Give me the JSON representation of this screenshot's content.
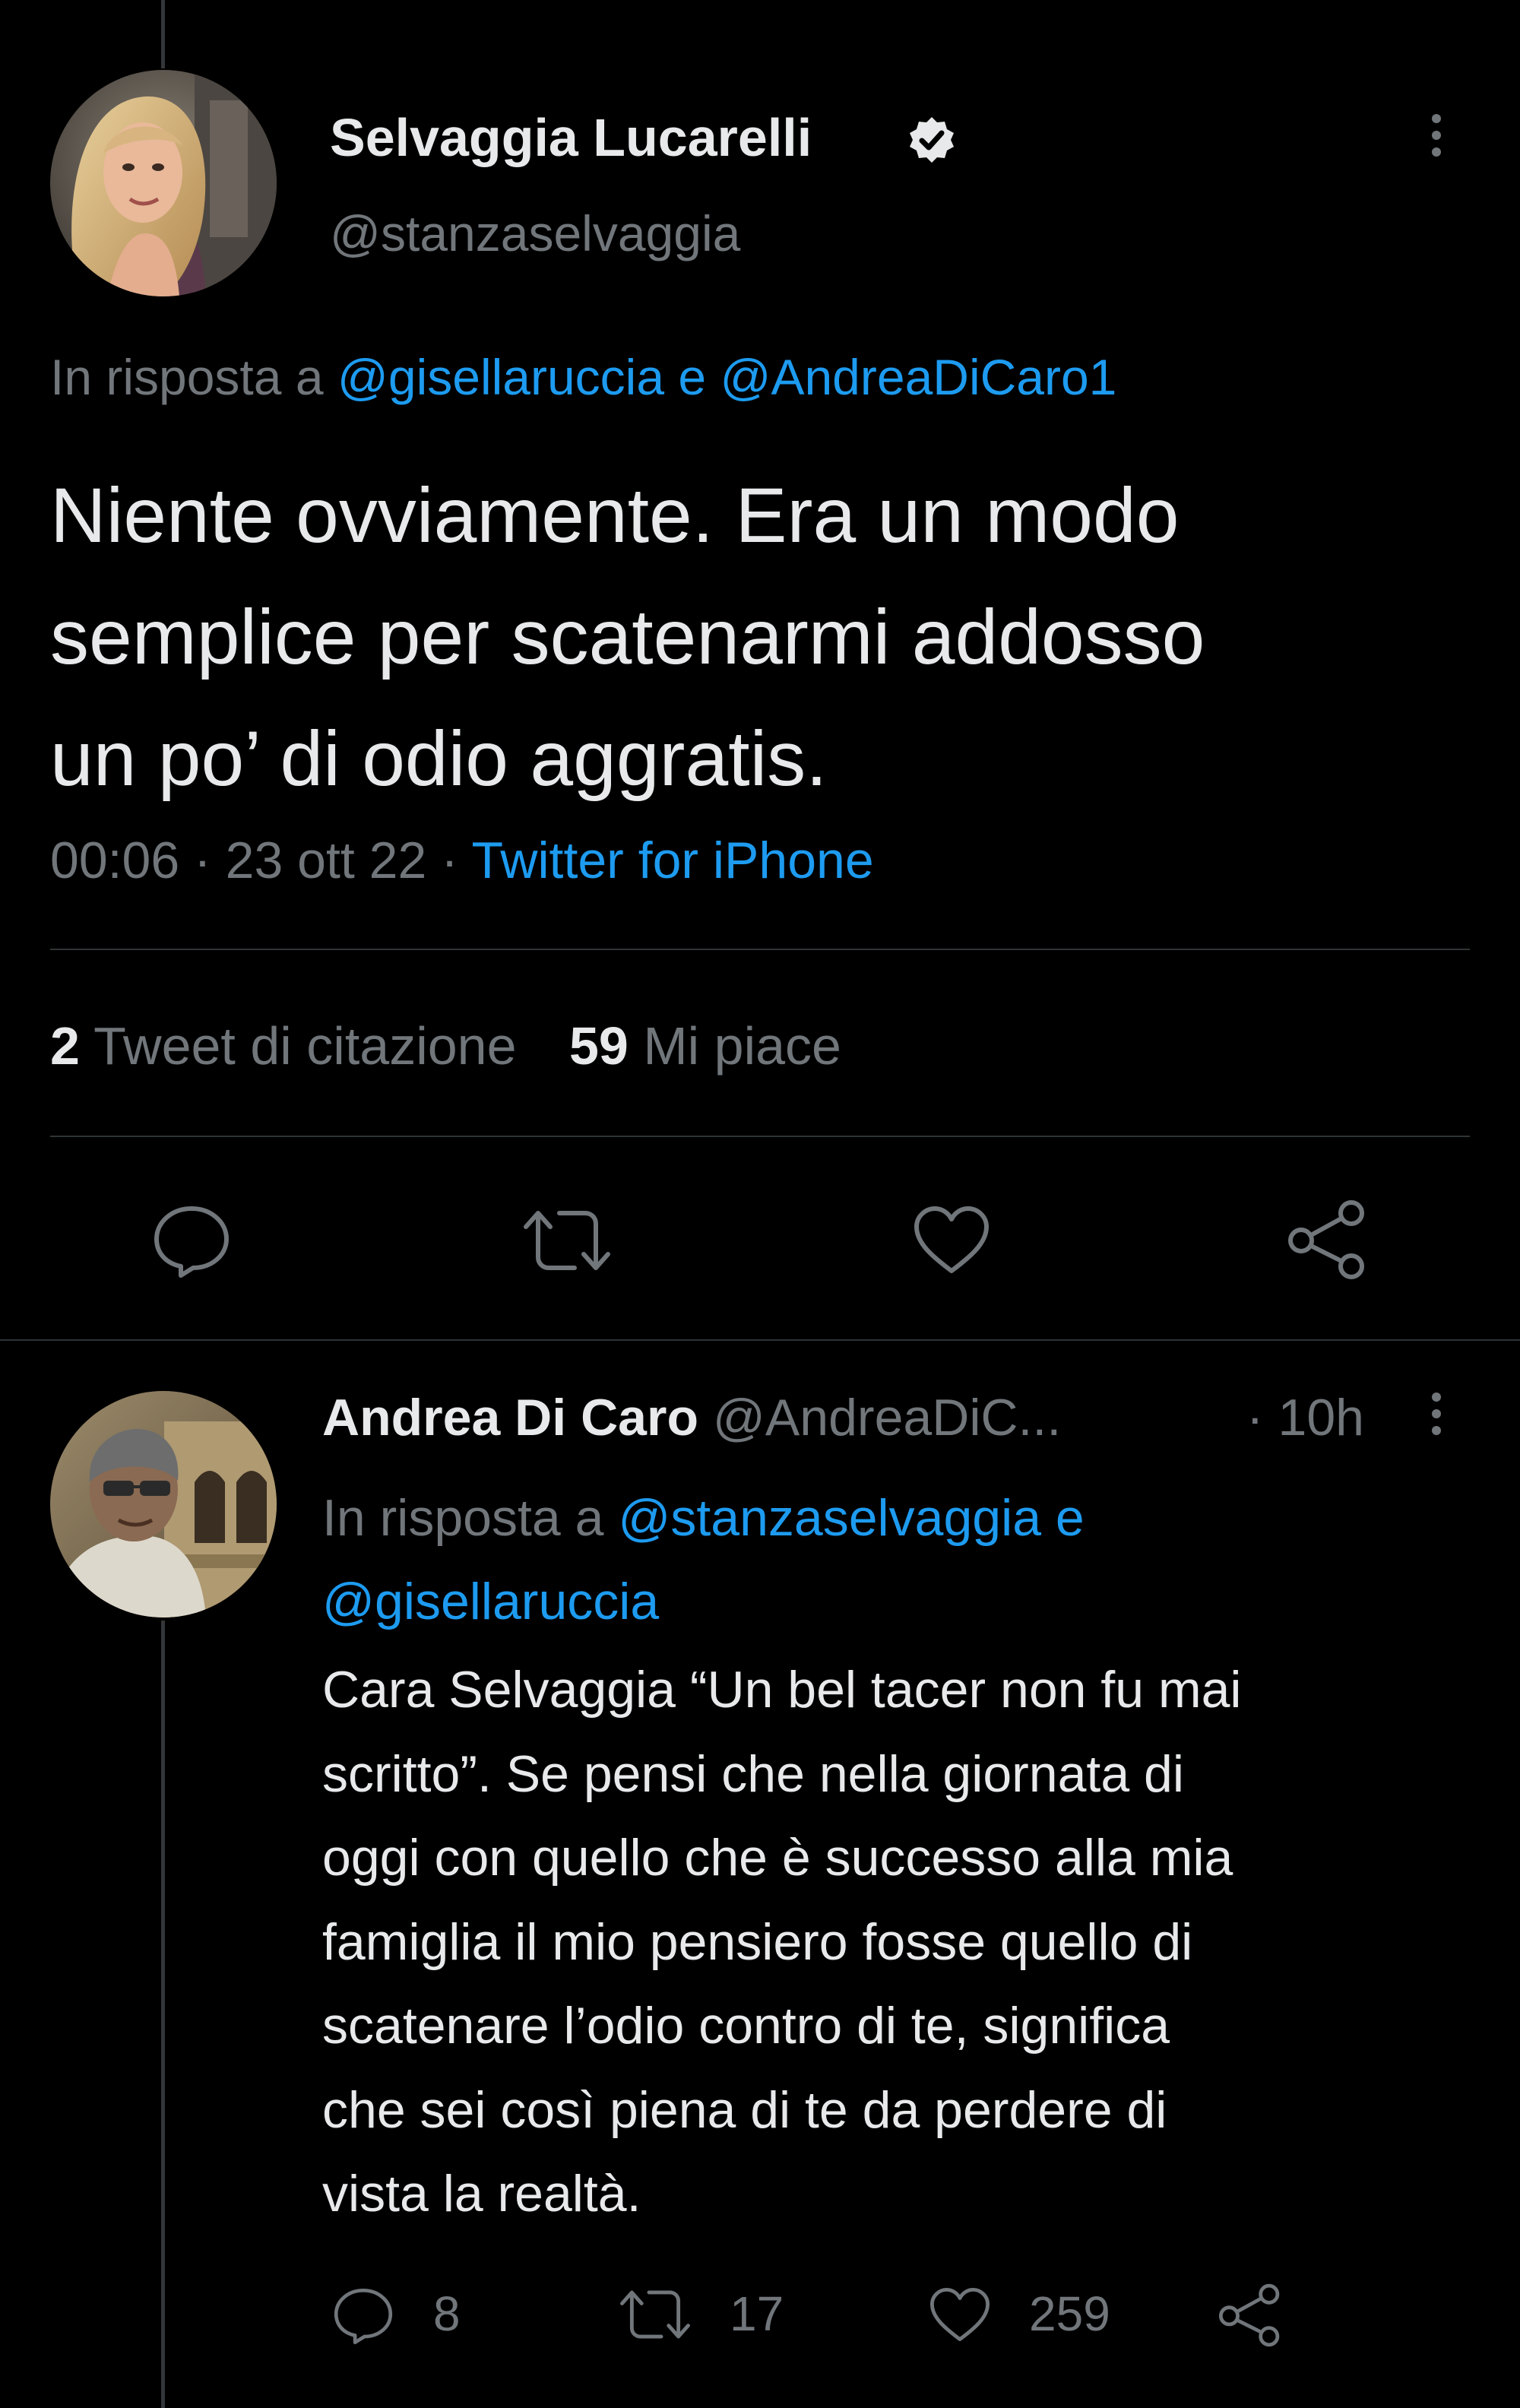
{
  "colors": {
    "background": "#000000",
    "text": "#e7e9ea",
    "muted": "#71767b",
    "link": "#1d9bf0",
    "divider": "#2f3336"
  },
  "main_tweet": {
    "author_name": "Selvaggia Lucarelli",
    "verified_icon": "verified-badge-icon",
    "handle": "@stanzaselvaggia",
    "reply_prefix": "In risposta a",
    "reply_user_1": "@gisellaruccia",
    "reply_conjunction": "e",
    "reply_user_2": "@AndreaDiCaro1",
    "text_line_1": "Niente ovviamente. Era un modo",
    "text_line_2": "semplice per scatenarmi addosso",
    "text_line_3": "un po’ di odio aggratis.",
    "time": "00:06",
    "separator": "·",
    "date": "23 ott 22",
    "source": "Twitter for iPhone",
    "quote_count": "2",
    "quote_label": "Tweet di citazione",
    "like_count": "59",
    "like_label": "Mi piace",
    "actions": [
      "reply-icon",
      "retweet-icon",
      "like-icon",
      "share-icon"
    ]
  },
  "reply_tweet": {
    "author_name": "Andrea Di Caro",
    "handle": "@AndreaDiC...",
    "time_ago": "· 10h",
    "reply_prefix": "In risposta a",
    "reply_user_1": "@stanzaselvaggia",
    "reply_conjunction": "e",
    "reply_user_2": "@gisellaruccia",
    "text_lines": [
      "Cara Selvaggia “Un bel tacer non fu mai",
      "scritto”. Se pensi che nella giornata di",
      "oggi con quello che è successo alla mia",
      "famiglia il mio pensiero fosse quello di",
      "scatenare l’odio contro di te, significa",
      "che sei così piena di te da perdere di",
      "vista la realtà."
    ],
    "reply_count": "8",
    "retweet_count": "17",
    "like_count": "259"
  }
}
